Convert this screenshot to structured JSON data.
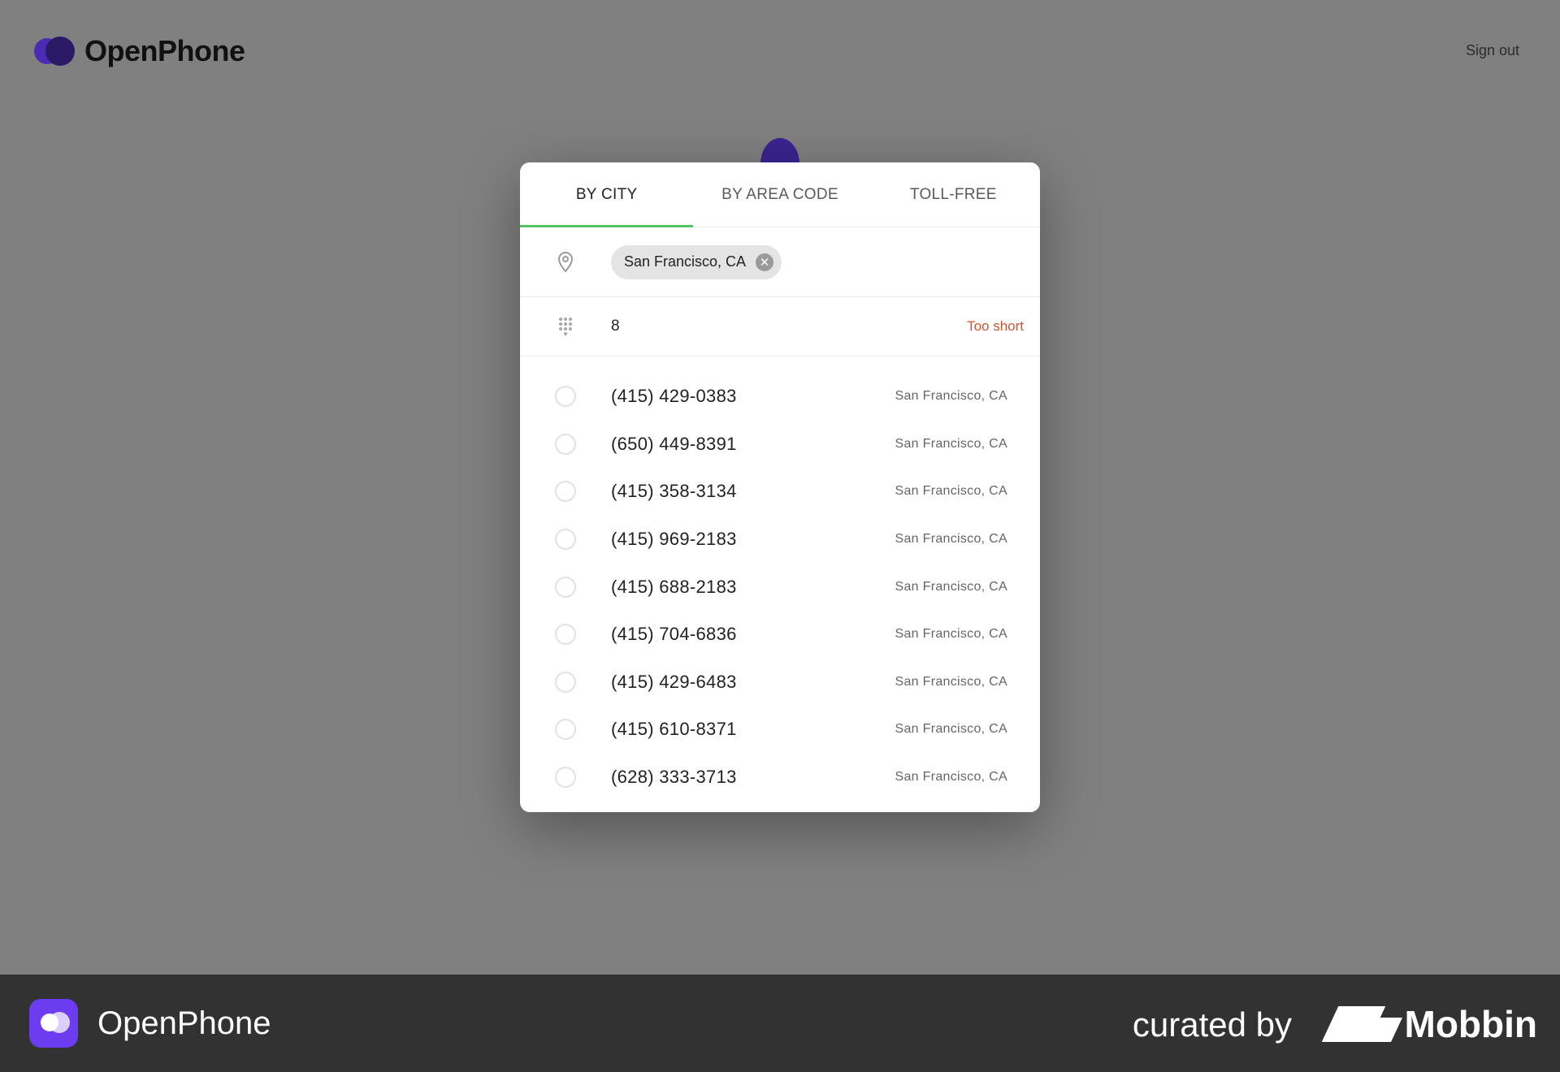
{
  "header": {
    "brand_name": "OpenPhone",
    "signout_label": "Sign out"
  },
  "modal": {
    "tabs": [
      {
        "label": "BY CITY",
        "active": true
      },
      {
        "label": "BY AREA CODE",
        "active": false
      },
      {
        "label": "TOLL-FREE",
        "active": false
      }
    ],
    "city_chip": "San Francisco, CA",
    "number_input_value": "8",
    "validation_message": "Too short",
    "numbers": [
      {
        "phone": "(415) 429-0383",
        "location": "San Francisco, CA"
      },
      {
        "phone": "(650) 449-8391",
        "location": "San Francisco, CA"
      },
      {
        "phone": "(415) 358-3134",
        "location": "San Francisco, CA"
      },
      {
        "phone": "(415) 969-2183",
        "location": "San Francisco, CA"
      },
      {
        "phone": "(415) 688-2183",
        "location": "San Francisco, CA"
      },
      {
        "phone": "(415) 704-6836",
        "location": "San Francisco, CA"
      },
      {
        "phone": "(415) 429-6483",
        "location": "San Francisco, CA"
      },
      {
        "phone": "(415) 610-8371",
        "location": "San Francisco, CA"
      },
      {
        "phone": "(628) 333-3713",
        "location": "San Francisco, CA"
      }
    ]
  },
  "footer": {
    "app_name": "OpenPhone",
    "curated_by": "curated by",
    "mobbin": "Mobbin"
  },
  "colors": {
    "tab_indicator": "#55c26a",
    "error": "#d2542e",
    "brand": "#4b2bb3"
  },
  "icons": [
    "location-pin-icon",
    "dialpad-icon",
    "clear-chip-icon"
  ]
}
